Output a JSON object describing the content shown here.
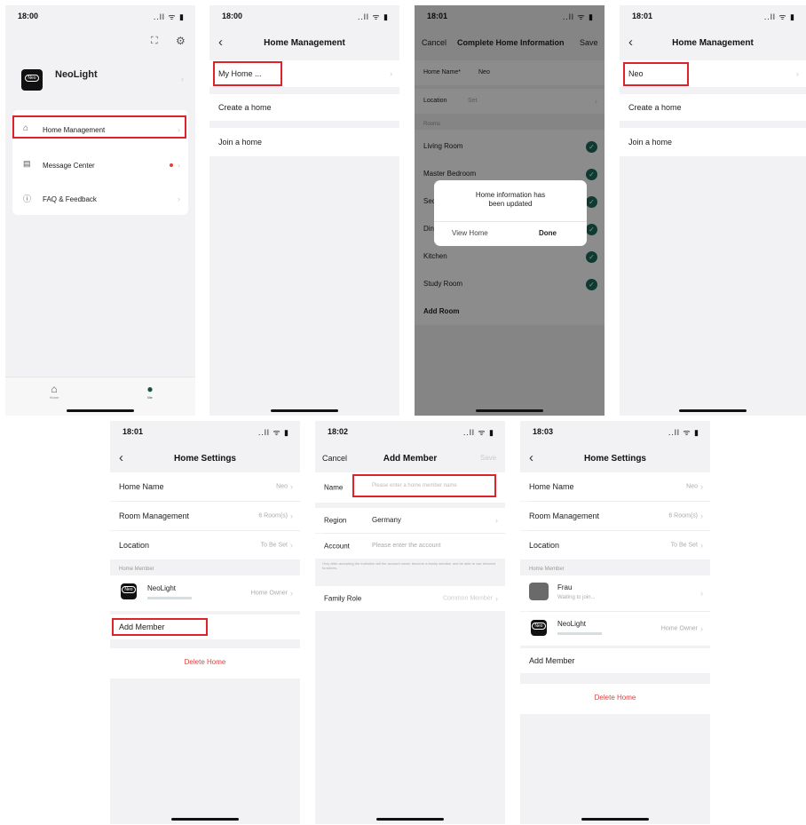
{
  "screen1": {
    "time": "18:00",
    "status_icons": "..ll ᯤ ▮",
    "profile_name": "NeoLight",
    "logo_text": "Neo",
    "menu": [
      {
        "label": "Home Management"
      },
      {
        "label": "Message Center"
      },
      {
        "label": "FAQ & Feedback"
      }
    ],
    "tabs": [
      {
        "label": "Home"
      },
      {
        "label": "Me"
      }
    ]
  },
  "screen2": {
    "time": "18:00",
    "status_icons": "..ll ᯤ ▮",
    "title": "Home Management",
    "home_item": "My Home ...",
    "create": "Create a home",
    "join": "Join a home"
  },
  "screen3": {
    "time": "18:01",
    "status_icons": "..ll ᯤ ▮",
    "cancel": "Cancel",
    "title": "Complete Home Information",
    "save": "Save",
    "home_name_label": "Home Name*",
    "home_name_value": "Neo",
    "location_label": "Location",
    "location_value": "Set",
    "rooms_header": "Rooms",
    "rooms": [
      "Living Room",
      "Master Bedroom",
      "Second Bedroom",
      "Dining Room",
      "Kitchen",
      "Study Room"
    ],
    "add_room": "Add Room",
    "dialog_line1": "Home information has",
    "dialog_line2": "been updated",
    "dialog_view": "View Home",
    "dialog_done": "Done"
  },
  "screen4": {
    "time": "18:01",
    "status_icons": "..ll ᯤ ▮",
    "title": "Home Management",
    "home_item": "Neo",
    "create": "Create a home",
    "join": "Join a home"
  },
  "screen5": {
    "time": "18:01",
    "status_icons": "..ll ᯤ ▮",
    "title": "Home Settings",
    "home_name_label": "Home Name",
    "home_name_value": "Neo",
    "room_mgmt_label": "Room Management",
    "room_mgmt_value": "6 Room(s)",
    "location_label": "Location",
    "location_value": "To Be Set",
    "member_header": "Home Member",
    "member_name": "NeoLight",
    "member_role": "Home Owner",
    "add_member": "Add Member",
    "delete_home": "Delete Home"
  },
  "screen6": {
    "time": "18:02",
    "status_icons": "..ll ᯤ ▮",
    "cancel": "Cancel",
    "title": "Add Member",
    "save": "Save",
    "name_label": "Name",
    "name_placeholder": "Please enter a home member name",
    "region_label": "Region",
    "region_value": "Germany",
    "account_label": "Account",
    "account_placeholder": "Please enter the account",
    "hint": "Only after accepting the invitation will the account owner become a family member and be able to use relevant functions.",
    "family_role_label": "Family Role",
    "family_role_value": "Common Member"
  },
  "screen7": {
    "time": "18:03",
    "status_icons": "..ll ᯤ ▮",
    "title": "Home Settings",
    "home_name_label": "Home Name",
    "home_name_value": "Neo",
    "room_mgmt_label": "Room Management",
    "room_mgmt_value": "6 Room(s)",
    "location_label": "Location",
    "location_value": "To Be Set",
    "member_header": "Home Member",
    "member1_name": "Frau",
    "member1_status": "Waiting to join...",
    "member2_name": "NeoLight",
    "member2_role": "Home Owner",
    "add_member": "Add Member",
    "delete_home": "Delete Home"
  },
  "colors": {
    "highlight": "#e0202a",
    "check": "#1d6b5a",
    "danger": "#e04040"
  }
}
